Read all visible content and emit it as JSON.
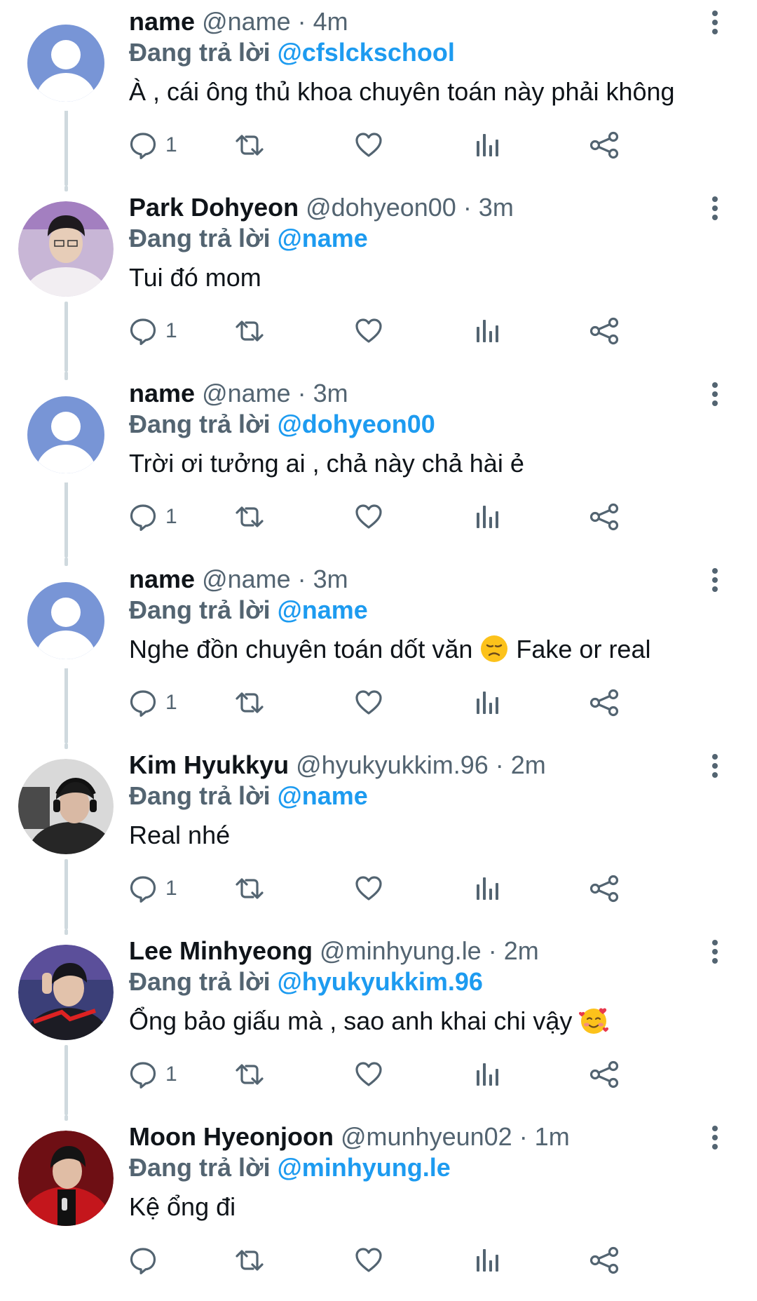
{
  "tweets": [
    {
      "name": "name",
      "handle_time": "@name · 4m",
      "reply_prefix": "Đang trả lời",
      "reply_to": "@cfslckschool",
      "text": "À , cái ông thủ khoa chuyên toán này phải không",
      "emoji": "",
      "text_after": "",
      "reply_count": "1",
      "avatar": "default-avatar-icon"
    },
    {
      "name": "Park Dohyeon",
      "handle_time": "@dohyeon00 · 3m",
      "reply_prefix": "Đang trả lời",
      "reply_to": "@name",
      "text": "Tui đó mom",
      "emoji": "",
      "text_after": "",
      "reply_count": "1",
      "avatar": "profile-photo"
    },
    {
      "name": "name",
      "handle_time": "@name · 3m",
      "reply_prefix": "Đang trả lời",
      "reply_to": "@dohyeon00",
      "text": "Trời ơi tưởng ai , chả này chả hài ẻ",
      "emoji": "",
      "text_after": "",
      "reply_count": "1",
      "avatar": "default-avatar-icon"
    },
    {
      "name": "name",
      "handle_time": "@name · 3m",
      "reply_prefix": "Đang trả lời",
      "reply_to": "@name",
      "text": "Nghe đồn chuyên toán dốt văn ",
      "emoji": "disappointed-face-emoji",
      "text_after": " Fake or real",
      "reply_count": "1",
      "avatar": "default-avatar-icon"
    },
    {
      "name": "Kim Hyukkyu",
      "handle_time": "@hyukyukkim.96 · 2m",
      "reply_prefix": "Đang trả lời",
      "reply_to": "@name",
      "text": "Real nhé",
      "emoji": "",
      "text_after": "",
      "reply_count": "1",
      "avatar": "profile-photo"
    },
    {
      "name": "Lee Minhyeong",
      "handle_time": "@minhyung.le · 2m",
      "reply_prefix": "Đang trả lời",
      "reply_to": "@hyukyukkim.96",
      "text": "Ổng bảo giấu mà , sao anh khai chi vậy ",
      "emoji": "smiling-face-with-hearts-emoji",
      "text_after": "",
      "reply_count": "1",
      "avatar": "profile-photo"
    },
    {
      "name": "Moon Hyeonjoon",
      "handle_time": "@munhyeun02 · 1m",
      "reply_prefix": "Đang trả lời",
      "reply_to": "@minhyung.le",
      "text": "Kệ ổng đi",
      "emoji": "",
      "text_after": "",
      "reply_count": "",
      "avatar": "profile-photo"
    }
  ],
  "action_icons": [
    "reply-icon",
    "retweet-icon",
    "like-icon",
    "analytics-icon",
    "share-icon"
  ],
  "colors": {
    "text": "#0f1419",
    "secondary": "#536471",
    "link": "#1d9bf0",
    "icon": "#536471",
    "thread_line": "#cfd9de",
    "default_avatar_bg": "#7895d6"
  }
}
